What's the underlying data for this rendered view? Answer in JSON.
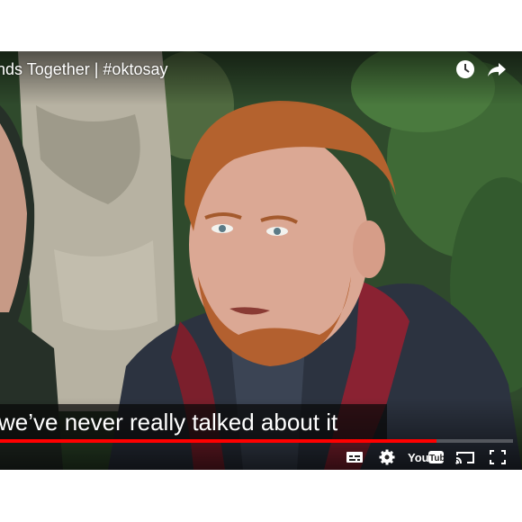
{
  "player": {
    "title": "nds Together | #oktosay",
    "caption": "we’ve never really talked about it",
    "progress_fraction": 0.85,
    "icons": {
      "watch_later": "clock-icon",
      "share": "share-arrow-icon",
      "subtitles": "subtitles-icon",
      "settings": "gear-icon",
      "youtube": "youtube-logo-icon",
      "cast": "cast-icon",
      "fullscreen": "fullscreen-icon"
    },
    "colors": {
      "progress": "#ff0000",
      "caption_bg": "#080808"
    }
  }
}
